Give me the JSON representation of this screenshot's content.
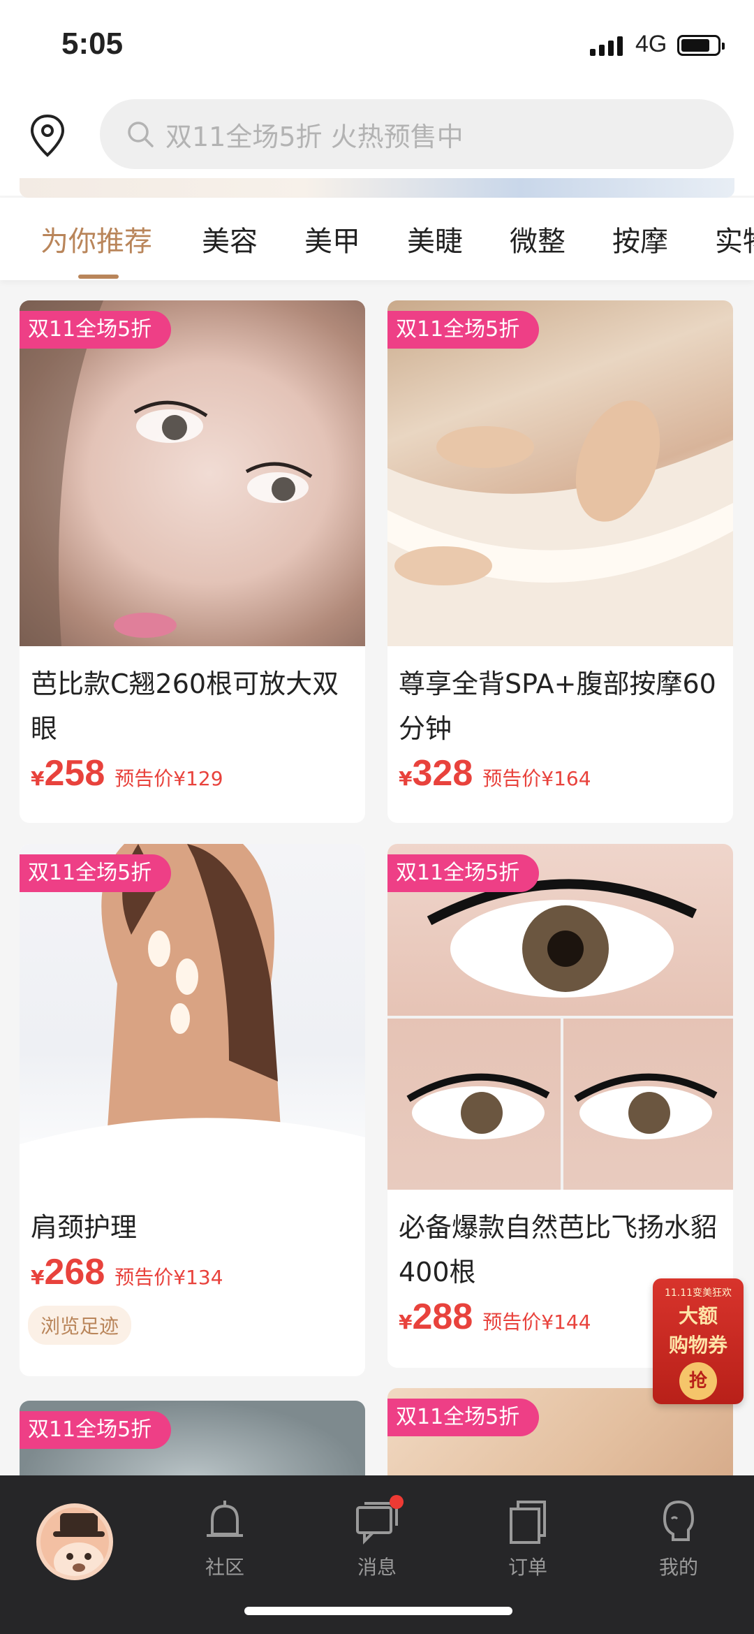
{
  "status_bar": {
    "time": "5:05",
    "network": "4G"
  },
  "search": {
    "placeholder": "双11全场5折 火热预售中"
  },
  "tabs": [
    {
      "label": "为你推荐",
      "active": true
    },
    {
      "label": "美容",
      "active": false
    },
    {
      "label": "美甲",
      "active": false
    },
    {
      "label": "美睫",
      "active": false
    },
    {
      "label": "微整",
      "active": false
    },
    {
      "label": "按摩",
      "active": false
    },
    {
      "label": "实物",
      "active": false
    }
  ],
  "products": [
    {
      "badge": "双11全场5折",
      "title": "芭比款C翘260根可放大双眼",
      "currency": "¥",
      "price": "258",
      "presale": "预告价¥129",
      "image": "eyelash-model-face"
    },
    {
      "badge": "双11全场5折",
      "title": "尊享全背SPA+腹部按摩60分钟",
      "currency": "¥",
      "price": "328",
      "presale": "预告价¥164",
      "image": "abdominal-massage"
    },
    {
      "badge": "双11全场5折",
      "title": "肩颈护理",
      "currency": "¥",
      "price": "268",
      "presale": "预告价¥134",
      "history": "浏览足迹",
      "image": "back-with-petals"
    },
    {
      "badge": "双11全场5折",
      "title": "必备爆款自然芭比飞扬水貂400根",
      "currency": "¥",
      "price": "288",
      "presale": "预告价¥144",
      "image": "eyelash-closeups"
    },
    {
      "badge": "双11全场5折",
      "image": "facial-treatment"
    },
    {
      "badge": "双11全场5折",
      "image": "hand-treatment"
    }
  ],
  "coupon": {
    "top": "11.11变美狂欢",
    "line1": "大额",
    "line2": "购物券",
    "grab": "抢"
  },
  "bottom_nav": [
    {
      "label": "",
      "icon": "mascot-avatar-icon"
    },
    {
      "label": "社区",
      "icon": "bell-icon"
    },
    {
      "label": "消息",
      "icon": "message-icon",
      "has_dot": true
    },
    {
      "label": "订单",
      "icon": "order-icon"
    },
    {
      "label": "我的",
      "icon": "profile-icon"
    }
  ],
  "colors": {
    "accent": "#b9855a",
    "badge": "#ee3f86",
    "price": "#e8423c",
    "nav_bg": "#262628"
  }
}
